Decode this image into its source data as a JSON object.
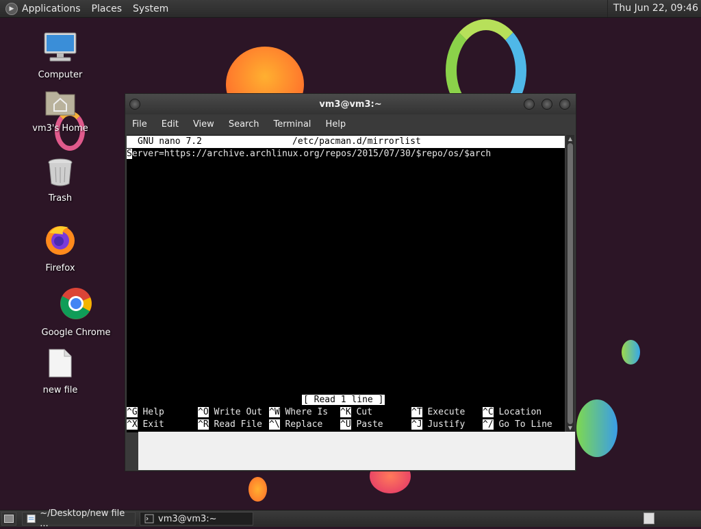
{
  "top_panel": {
    "menus": [
      "Applications",
      "Places",
      "System"
    ],
    "clock": "Thu Jun 22, 09:46"
  },
  "desktop_icons": [
    {
      "label": "Computer",
      "icon": "computer-icon"
    },
    {
      "label": "vm3's Home",
      "icon": "home-folder-icon"
    },
    {
      "label": "Trash",
      "icon": "trash-icon"
    },
    {
      "label": "Firefox",
      "icon": "firefox-icon"
    },
    {
      "label": "Google Chrome",
      "icon": "chrome-icon"
    },
    {
      "label": "new file",
      "icon": "file-icon"
    }
  ],
  "terminal": {
    "title": "vm3@vm3:~",
    "menu": [
      "File",
      "Edit",
      "View",
      "Search",
      "Terminal",
      "Help"
    ],
    "nano": {
      "version": "GNU nano 7.2",
      "filename": "/etc/pacman.d/mirrorlist",
      "cursor_char": "S",
      "line_rest": "erver=https://archive.archlinux.org/repos/2015/07/30/$repo/os/$arch",
      "status": "[ Read 1 line ]",
      "shortcuts_row1": [
        {
          "key": "^G",
          "label": "Help"
        },
        {
          "key": "^O",
          "label": "Write Out"
        },
        {
          "key": "^W",
          "label": "Where Is"
        },
        {
          "key": "^K",
          "label": "Cut"
        },
        {
          "key": "^T",
          "label": "Execute"
        },
        {
          "key": "^C",
          "label": "Location"
        }
      ],
      "shortcuts_row2": [
        {
          "key": "^X",
          "label": "Exit"
        },
        {
          "key": "^R",
          "label": "Read File"
        },
        {
          "key": "^\\",
          "label": "Replace"
        },
        {
          "key": "^U",
          "label": "Paste"
        },
        {
          "key": "^J",
          "label": "Justify"
        },
        {
          "key": "^/",
          "label": "Go To Line"
        }
      ]
    }
  },
  "taskbar": {
    "items": [
      {
        "label": "~/Desktop/new file ...",
        "icon": "text-editor-icon"
      },
      {
        "label": "vm3@vm3:~",
        "icon": "terminal-icon"
      }
    ]
  },
  "colors": {
    "wallpaper": "#2c1526",
    "panel": "#333333",
    "terminal_bg": "#000000"
  }
}
